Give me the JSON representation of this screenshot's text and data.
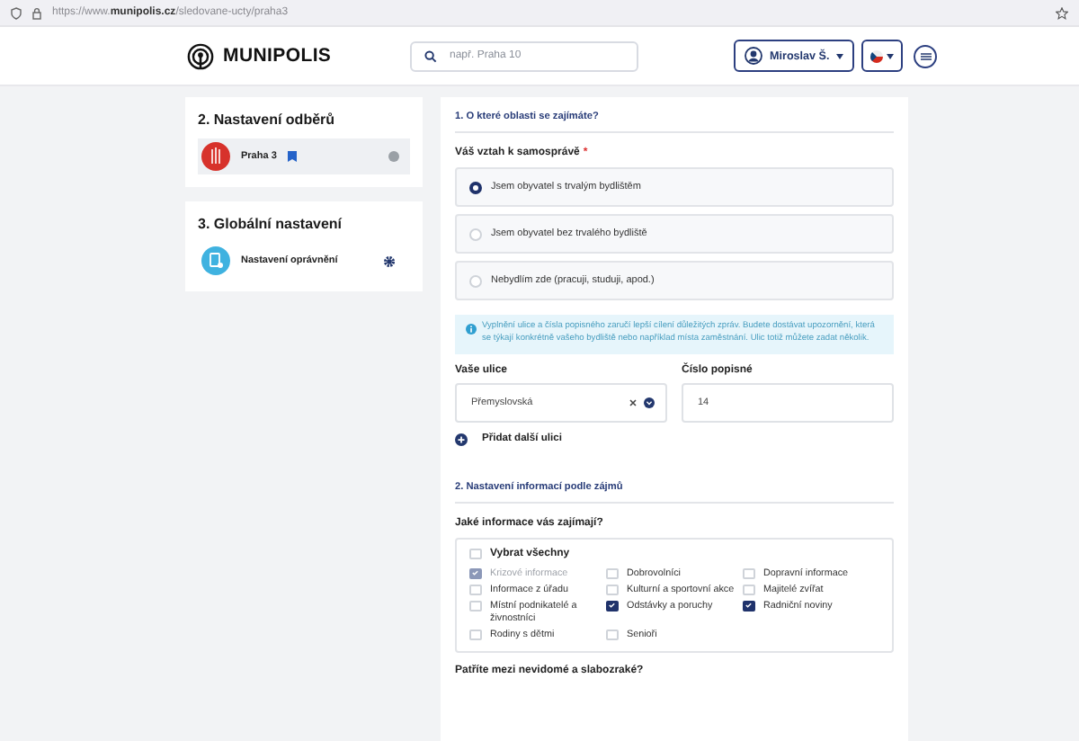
{
  "browser": {
    "url": "https://www.**munipolis.cz**/sledovane-ucty/praha3"
  },
  "header": {
    "logo": "MUNIPOLIS",
    "search": {
      "placeholder": "např. Praha 10"
    },
    "user": "Miroslav Š."
  },
  "sidebar": [
    {
      "title": "2. Nastavení odběrů",
      "items": [
        {
          "kind": "city",
          "label": "Praha 3",
          "selected": true
        }
      ]
    },
    {
      "title": "3. Globální nastavení",
      "items": [
        {
          "kind": "settings",
          "label": "Nastavení oprávnění",
          "selected": false
        }
      ]
    }
  ],
  "section1": {
    "title": "1. O které oblasti se zajímáte?",
    "question": "Váš vztah k samosprávě",
    "required": "*",
    "options": [
      {
        "label": "Jsem obyvatel s trvalým bydlištěm",
        "selected": true
      },
      {
        "label": "Jsem obyvatel bez trvalého bydliště",
        "selected": false
      },
      {
        "label": "Nebydlím zde (pracuji, studuji, apod.)",
        "selected": false
      }
    ],
    "info": "Vyplnění ulice a čísla popisného zaručí lepší cílení důležitých zpráv. Budete dostávat upozornění, která se týkají konkrétně vašeho bydliště nebo například místa zaměstnání. Ulic totiž můžete zadat několik.",
    "street": {
      "label": "Vaše ulice",
      "value": "Přemyslovská"
    },
    "number": {
      "label": "Číslo popisné",
      "value": "14"
    },
    "add": "Přidat další ulici"
  },
  "section2": {
    "title": "2. Nastavení informací podle zájmů",
    "question": "Jaké informace vás zajímají?",
    "select_all": {
      "label": "Vybrat všechny",
      "checked": false
    },
    "options": [
      {
        "label": "Krizové informace",
        "checked": true,
        "disabled": true
      },
      {
        "label": "Dobrovolníci",
        "checked": false,
        "disabled": false
      },
      {
        "label": "Dopravní informace",
        "checked": false,
        "disabled": false
      },
      {
        "label": "Informace z úřadu",
        "checked": false,
        "disabled": false
      },
      {
        "label": "Kulturní a sportovní akce",
        "checked": false,
        "disabled": false
      },
      {
        "label": "Majitelé zvířat",
        "checked": false,
        "disabled": false
      },
      {
        "label": "Místní podnikatelé a živnostníci",
        "checked": false,
        "disabled": false
      },
      {
        "label": "Odstávky a poruchy",
        "checked": true,
        "disabled": false
      },
      {
        "label": "Radniční noviny",
        "checked": true,
        "disabled": false
      },
      {
        "label": "Rodiny s dětmi",
        "checked": false,
        "disabled": false
      },
      {
        "label": "Senioři",
        "checked": false,
        "disabled": false
      }
    ],
    "next_question": "Patříte mezi nevidomé a slabozraké?"
  }
}
